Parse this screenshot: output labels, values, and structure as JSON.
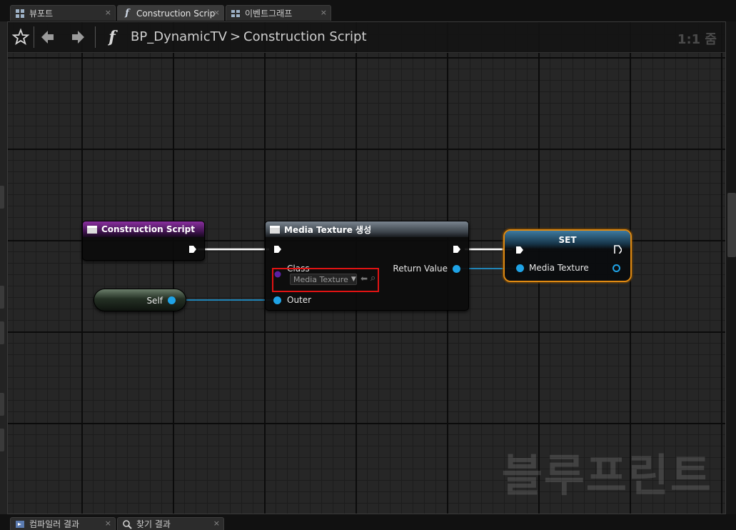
{
  "tabs": [
    {
      "label": "뷰포트",
      "icon": "viewport-grid-icon",
      "close": "×"
    },
    {
      "label": "Construction Scrip",
      "icon": "function-icon",
      "close": "×"
    },
    {
      "label": "이벤트그래프",
      "icon": "event-graph-icon",
      "close": "×"
    }
  ],
  "toolbar": {
    "favorite_icon": "star-icon",
    "back_icon": "arrow-left-icon",
    "forward_icon": "arrow-right-icon",
    "function_glyph": "f",
    "breadcrumb_blueprint": "BP_DynamicTV",
    "breadcrumb_separator": ">",
    "breadcrumb_graph": "Construction Script",
    "zoom_label": "1:1 줌"
  },
  "nodes": {
    "construction_script": {
      "title": "Construction Script"
    },
    "create_media_texture": {
      "title": "Media Texture 생성",
      "class_pin_label": "Class",
      "class_value": "Media Texture",
      "outer_pin_label": "Outer",
      "return_pin_label": "Return Value"
    },
    "self": {
      "label": "Self"
    },
    "set": {
      "title": "SET",
      "pin_label": "Media Texture"
    }
  },
  "watermark": "블루프린트",
  "bottom_tabs": [
    {
      "label": "컴파일러 결과",
      "icon": "compiler-results-icon",
      "close": "×"
    },
    {
      "label": "찾기 결과",
      "icon": "find-results-icon",
      "close": "×"
    }
  ],
  "colors": {
    "exec_wire": "#ffffff",
    "object_wire": "#1fa3e6",
    "highlight_box": "#e01313",
    "selected_outline": "#e08a12"
  }
}
